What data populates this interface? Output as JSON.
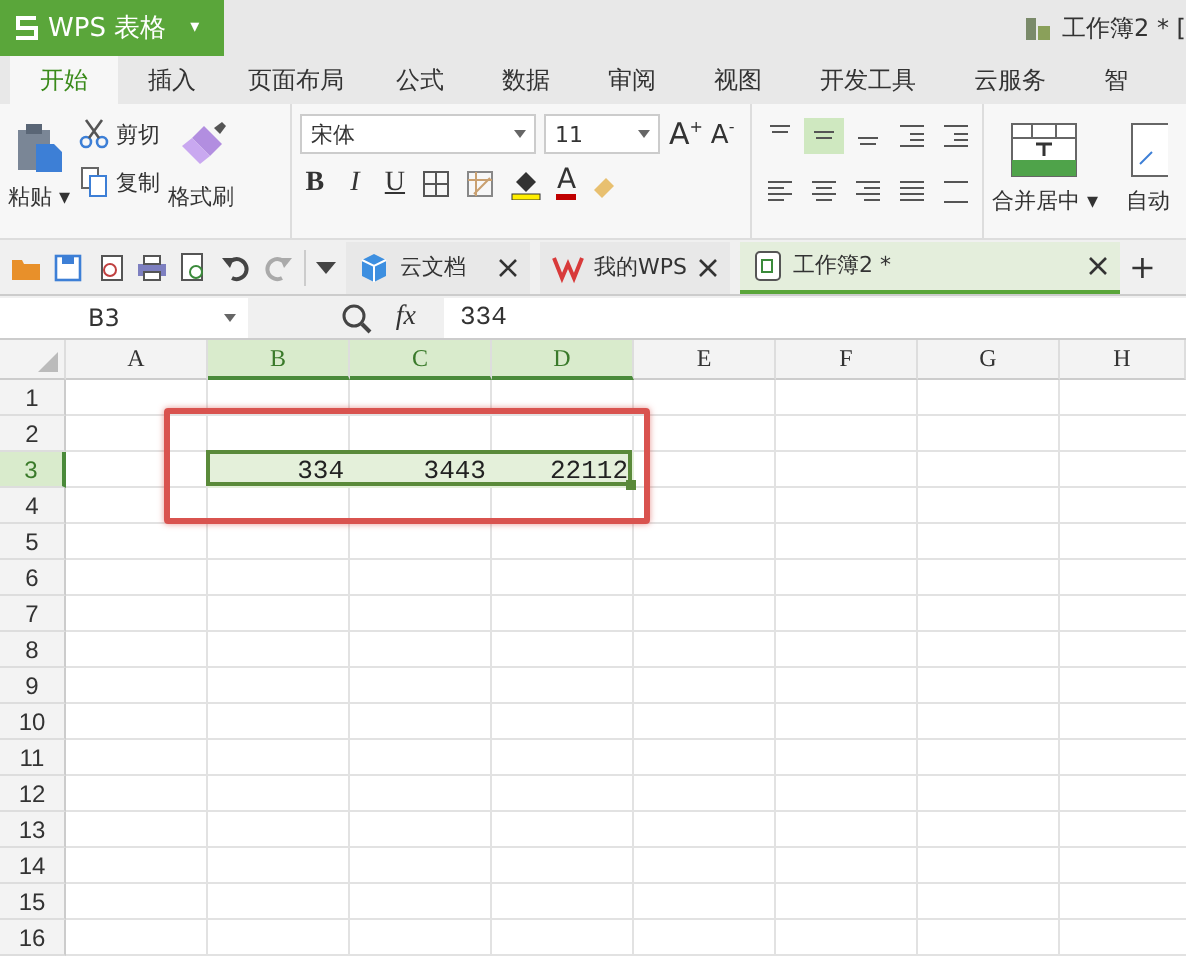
{
  "title_bar": {
    "app_name": "WPS 表格",
    "menu_arrow": "▾",
    "document_title": "工作簿2 * ["
  },
  "tabs": [
    {
      "label": "开始",
      "selected": true
    },
    {
      "label": "插入",
      "selected": false
    },
    {
      "label": "页面布局",
      "selected": false
    },
    {
      "label": "公式",
      "selected": false
    },
    {
      "label": "数据",
      "selected": false
    },
    {
      "label": "审阅",
      "selected": false
    },
    {
      "label": "视图",
      "selected": false
    },
    {
      "label": "开发工具",
      "selected": false
    },
    {
      "label": "云服务",
      "selected": false
    },
    {
      "label": "智",
      "selected": false
    }
  ],
  "ribbon": {
    "paste": "粘贴 ▾",
    "cut": "剪切",
    "copy": "复制",
    "format_painter": "格式刷",
    "font": "宋体",
    "font_size": "11",
    "grow_font": "A",
    "grow_sign": "+",
    "shrink_font": "A",
    "shrink_sign": "-",
    "bold": "B",
    "italic": "I",
    "underline": "U",
    "font_color": "A",
    "align_buttons": [
      {
        "selected": false
      },
      {
        "selected": true
      },
      {
        "selected": false
      },
      {
        "selected": false
      },
      {
        "selected": false
      },
      {
        "selected": false
      },
      {
        "selected": false
      },
      {
        "selected": false
      },
      {
        "selected": false
      },
      {
        "selected": false
      }
    ],
    "merge": "合并居中 ▾",
    "wrap": "自动"
  },
  "doc_tabs": [
    {
      "label": "云文档",
      "kind": "cloud",
      "selected": false
    },
    {
      "label": "我的WPS",
      "kind": "wps",
      "selected": false
    },
    {
      "label": "工作簿2 *",
      "kind": "sheet",
      "selected": true
    }
  ],
  "new_tab": "+",
  "formula_bar": {
    "cell_ref": "B3",
    "fx": "fx",
    "value": "334"
  },
  "sheet": {
    "columns": [
      {
        "label": "A",
        "selected": false
      },
      {
        "label": "B",
        "selected": true
      },
      {
        "label": "C",
        "selected": true
      },
      {
        "label": "D",
        "selected": true
      },
      {
        "label": "E",
        "selected": false
      },
      {
        "label": "F",
        "selected": false
      },
      {
        "label": "G",
        "selected": false
      },
      {
        "label": "H",
        "selected": false
      }
    ],
    "rows": [
      {
        "label": "1",
        "selected": false,
        "cells": []
      },
      {
        "label": "2",
        "selected": false,
        "cells": []
      },
      {
        "label": "3",
        "selected": true,
        "cells": [
          "",
          "334",
          "3443",
          "22112"
        ]
      },
      {
        "label": "4",
        "selected": false,
        "cells": []
      },
      {
        "label": "5",
        "selected": false,
        "cells": []
      },
      {
        "label": "6",
        "selected": false,
        "cells": []
      },
      {
        "label": "7",
        "selected": false,
        "cells": []
      },
      {
        "label": "8",
        "selected": false,
        "cells": []
      },
      {
        "label": "9",
        "selected": false,
        "cells": []
      },
      {
        "label": "10",
        "selected": false,
        "cells": []
      },
      {
        "label": "11",
        "selected": false,
        "cells": []
      },
      {
        "label": "12",
        "selected": false,
        "cells": []
      },
      {
        "label": "13",
        "selected": false,
        "cells": []
      },
      {
        "label": "14",
        "selected": false,
        "cells": []
      },
      {
        "label": "15",
        "selected": false,
        "cells": []
      },
      {
        "label": "16",
        "selected": false,
        "cells": []
      }
    ],
    "highlight_box": true
  }
}
